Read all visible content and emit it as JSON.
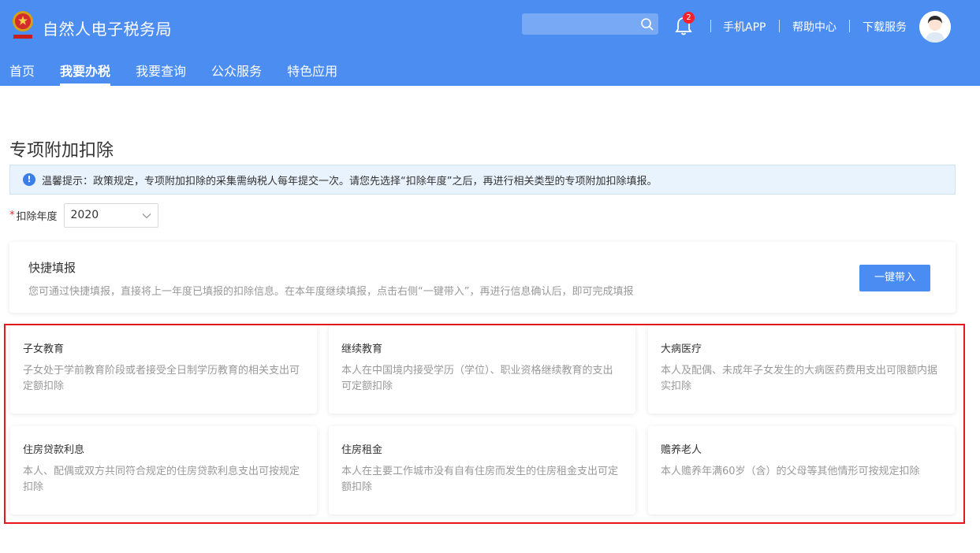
{
  "header": {
    "title": "自然人电子税务局",
    "search_placeholder": "",
    "notification_count": "2",
    "links": [
      "手机APP",
      "帮助中心",
      "下载服务"
    ]
  },
  "nav": {
    "items": [
      {
        "label": "首页",
        "active": false
      },
      {
        "label": "我要办税",
        "active": true
      },
      {
        "label": "我要查询",
        "active": false
      },
      {
        "label": "公众服务",
        "active": false
      },
      {
        "label": "特色应用",
        "active": false
      }
    ]
  },
  "page": {
    "title": "专项附加扣除",
    "tip": "温馨提示：政策规定，专项附加扣除的采集需纳税人每年提交一次。请您先选择“扣除年度”之后，再进行相关类型的专项附加扣除填报。",
    "year_label": "扣除年度",
    "year_value": "2020"
  },
  "quick": {
    "title": "快捷填报",
    "desc": "您可通过快捷填报，直接将上一年度已填报的扣除信息。在本年度继续填报，点击右侧“一键带入”，再进行信息确认后，即可完成填报",
    "button": "一键带入"
  },
  "cards": [
    {
      "title": "子女教育",
      "desc": "子女处于学前教育阶段或者接受全日制学历教育的相关支出可定额扣除"
    },
    {
      "title": "继续教育",
      "desc": "本人在中国境内接受学历（学位）、职业资格继续教育的支出可定额扣除"
    },
    {
      "title": "大病医疗",
      "desc": "本人及配偶、未成年子女发生的大病医药费用支出可限额内据实扣除"
    },
    {
      "title": "住房贷款利息",
      "desc": "本人、配偶或双方共同符合规定的住房贷款利息支出可按规定扣除"
    },
    {
      "title": "住房租金",
      "desc": "本人在主要工作城市没有自有住房而发生的住房租金支出可定额扣除"
    },
    {
      "title": "赡养老人",
      "desc": "本人赡养年满60岁（含）的父母等其他情形可按规定扣除"
    }
  ],
  "colors": {
    "header_bg": "#4b8df1",
    "primary_button": "#4a8cf1",
    "highlight_border": "#e5191d",
    "badge": "#f5222d"
  }
}
